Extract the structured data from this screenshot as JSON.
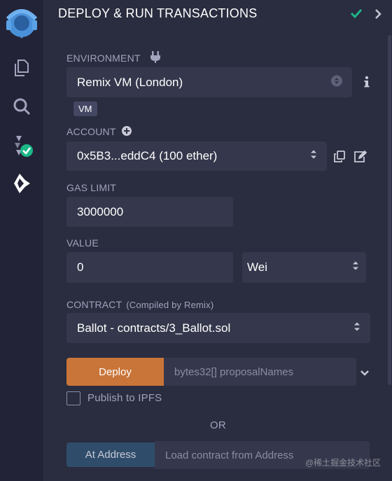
{
  "header": {
    "title": "DEPLOY & RUN TRANSACTIONS"
  },
  "environment": {
    "label": "ENVIRONMENT",
    "value": "Remix VM (London)",
    "badge": "VM"
  },
  "account": {
    "label": "ACCOUNT",
    "value": "0x5B3...eddC4 (100 ether)"
  },
  "gas_limit": {
    "label": "GAS LIMIT",
    "value": "3000000"
  },
  "value": {
    "label": "VALUE",
    "amount": "0",
    "unit": "Wei"
  },
  "contract": {
    "label": "CONTRACT",
    "sublabel": "(Compiled by Remix)",
    "value": "Ballot - contracts/3_Ballot.sol"
  },
  "deploy": {
    "button": "Deploy",
    "placeholder": "bytes32[] proposalNames"
  },
  "publish": {
    "label": "Publish to IPFS",
    "checked": false
  },
  "or_text": "OR",
  "at_address": {
    "button": "At Address",
    "placeholder": "Load contract from Address"
  },
  "watermark": "@稀土掘金技术社区",
  "colors": {
    "accent_check": "#1bb787",
    "deploy_orange": "#c97539",
    "at_address_blue": "#2f4d6b",
    "panel_bg": "#2a2c3f",
    "sidebar_bg": "#222336",
    "logo_blue": "#4a90d9"
  },
  "icons": [
    "remix-logo-icon",
    "file-explorer-icon",
    "search-icon",
    "solidity-compiler-icon",
    "deploy-run-icon",
    "plug-icon",
    "plus-circle-icon",
    "info-icon",
    "copy-icon",
    "edit-icon",
    "check-icon",
    "chevron-right-icon",
    "chevron-down-icon"
  ]
}
